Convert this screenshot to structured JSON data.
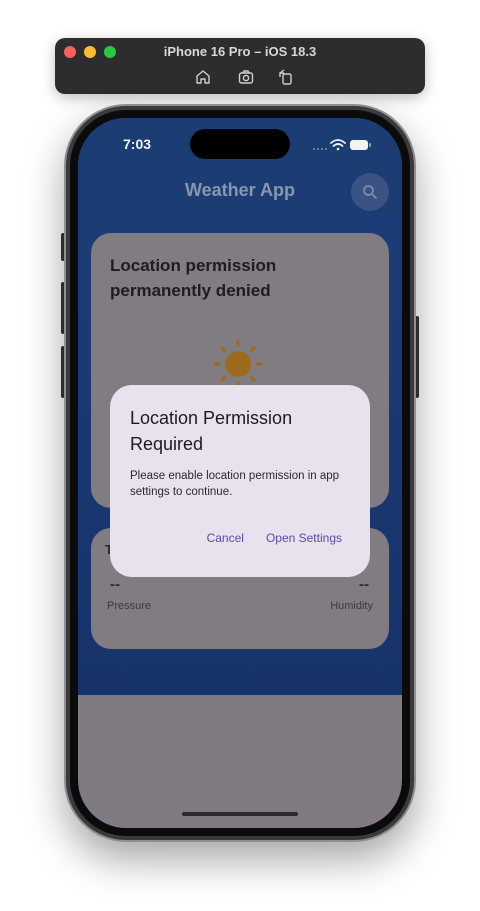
{
  "simulator": {
    "title": "iPhone 16 Pro – iOS 18.3",
    "toolbar_icons": [
      "home-icon",
      "screenshot-icon",
      "rotate-icon"
    ]
  },
  "status_bar": {
    "time": "7:03",
    "icons": [
      "signal-icon",
      "wifi-icon",
      "battery-icon"
    ]
  },
  "app": {
    "title": "Weather App",
    "search_icon": "search-icon",
    "weather_card": {
      "message": "Location permission permanently denied",
      "icon": "sun-icon"
    },
    "details_card": {
      "peek_text": "T",
      "pressure": {
        "value": "--",
        "label": "Pressure"
      },
      "humidity": {
        "value": "--",
        "label": "Humidity"
      }
    }
  },
  "dialog": {
    "title": "Location Permission Required",
    "body": "Please enable location permission in app settings to continue.",
    "cancel_label": "Cancel",
    "confirm_label": "Open Settings"
  },
  "colors": {
    "app_background": "#1c3c74",
    "dialog_background": "#e8e1ee",
    "dialog_button": "#5b4aa2",
    "scrim": "#807a82",
    "sun": "#c98a1c"
  }
}
